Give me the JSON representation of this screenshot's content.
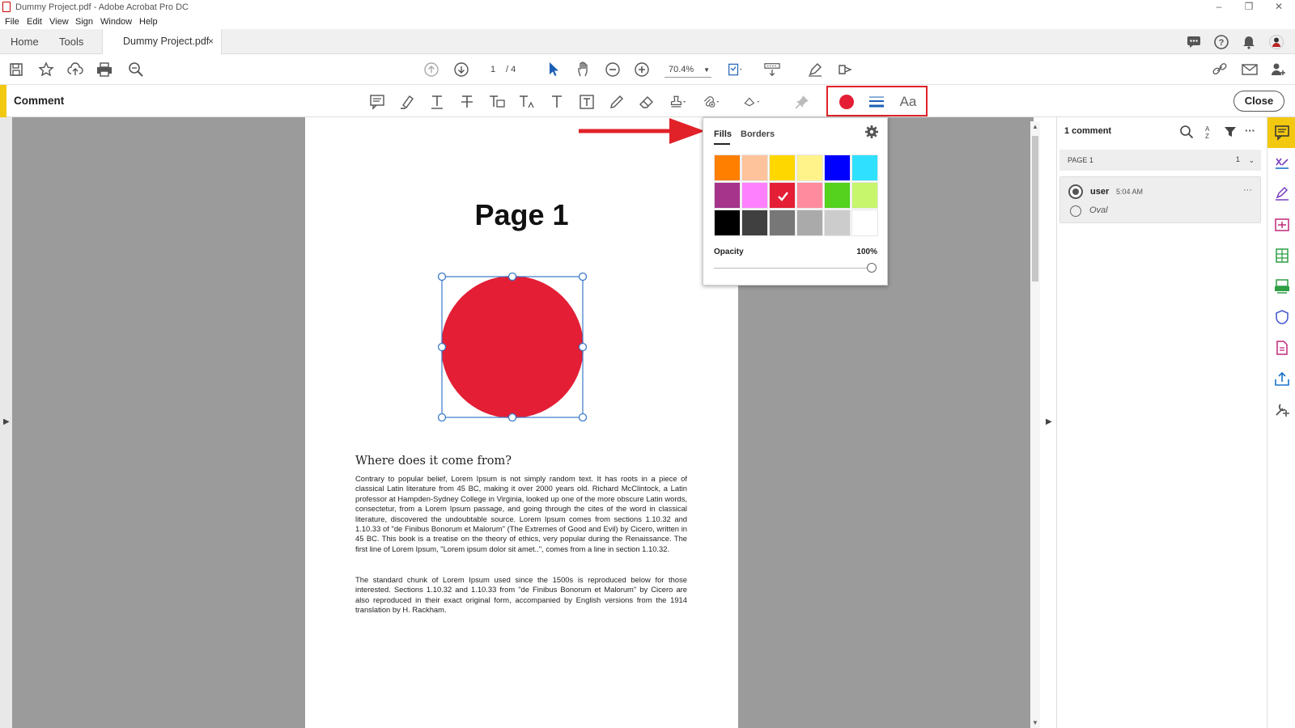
{
  "window": {
    "title": "Dummy Project.pdf - Adobe Acrobat Pro DC",
    "controls": [
      "–",
      "❐",
      "✕"
    ]
  },
  "menu": [
    "File",
    "Edit",
    "View",
    "Sign",
    "Window",
    "Help"
  ],
  "tabs": {
    "home": "Home",
    "tools": "Tools",
    "document": "Dummy Project.pdf",
    "close_glyph": "×"
  },
  "toolbar": {
    "page_current": "1",
    "page_total": "/ 4",
    "zoom": "70.4%"
  },
  "comment_bar": {
    "label": "Comment",
    "close_label": "Close",
    "accent_color": "#f2c811",
    "active_color": "#e31e35",
    "text_tool_label": "Aa"
  },
  "popup": {
    "tab_fills": "Fills",
    "tab_borders": "Borders",
    "opacity_label": "Opacity",
    "opacity_value": "100%",
    "opacity_fraction": 1.0,
    "swatches": [
      [
        "#ff7f00",
        "#ffc39b",
        "#ffd700",
        "#fff38a",
        "#0000ff",
        "#2fe0ff"
      ],
      [
        "#a5348a",
        "#ff80ff",
        "#e31e35",
        "#ff8c9e",
        "#54d21e",
        "#c7f56b"
      ],
      [
        "#000000",
        "#404040",
        "#777777",
        "#aaaaaa",
        "#cccccc",
        "#ffffff"
      ]
    ],
    "selected_swatch": [
      1,
      2
    ]
  },
  "document": {
    "page_title": "Page 1",
    "shape_color": "#e31e35",
    "heading": "Where does it come from?",
    "paragraph1": "Contrary to popular belief, Lorem Ipsum is not simply random text. It has roots in a piece of classical Latin literature from 45 BC, making it over 2000 years old. Richard McClintock, a Latin professor at Hampden-Sydney College in Virginia, looked up one of the more obscure Latin words, consectetur, from a Lorem Ipsum passage, and going through the cites of the word in classical literature, discovered the undoubtable source. Lorem Ipsum comes from sections 1.10.32 and 1.10.33 of \"de Finibus Bonorum et Malorum\" (The Extremes of Good and Evil) by Cicero, written in 45 BC. This book is a treatise on the theory of ethics, very popular during the Renaissance. The first line of Lorem Ipsum, \"Lorem ipsum dolor sit amet..\", comes from a line in section 1.10.32.",
    "paragraph2": "The standard chunk of Lorem Ipsum used since the 1500s is reproduced below for those interested. Sections 1.10.32 and 1.10.33 from \"de Finibus Bonorum et Malorum\" by Cicero are also reproduced in their exact original form, accompanied by English versions from the 1914 translation by H. Rackham."
  },
  "comments_panel": {
    "count": "1 comment",
    "page_header": "PAGE 1",
    "page_count": "1",
    "comment": {
      "user": "user",
      "time": "5:04 AM",
      "type": "Oval",
      "more": "···"
    },
    "more": "···"
  }
}
